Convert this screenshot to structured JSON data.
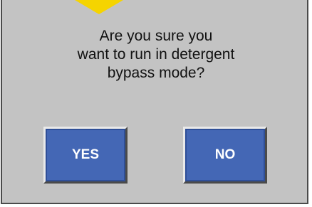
{
  "dialog": {
    "message_lines": [
      "Are you sure you",
      "want to run in detergent",
      "bypass mode?"
    ],
    "yes_label": "YES",
    "no_label": "NO"
  },
  "colors": {
    "dialog_background": "#c3c3c3",
    "button_blue": "#4467b5",
    "pointer_yellow": "#f5d400"
  },
  "icons": {
    "pointer": "callout-arrow-icon"
  }
}
